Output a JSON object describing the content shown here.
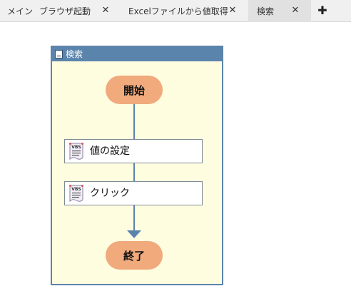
{
  "tabs": [
    {
      "label": "メイン",
      "closable": false,
      "active": false
    },
    {
      "label": "ブラウザ起動",
      "closable": true,
      "active": false
    },
    {
      "label": "Excelファイルから値取得",
      "closable": true,
      "active": false
    },
    {
      "label": "検索",
      "closable": true,
      "active": true
    }
  ],
  "tab_close_glyph": "✕",
  "tab_add_glyph": "✚",
  "flow": {
    "title": "検索",
    "start_label": "開始",
    "end_label": "終了",
    "actions": [
      {
        "label": "値の設定",
        "icon": "vbs-script-icon",
        "icon_text": "VBS"
      },
      {
        "label": "クリック",
        "icon": "vbs-script-icon",
        "icon_text": "VBS"
      }
    ]
  },
  "colors": {
    "accent_blue": "#5b84ad",
    "canvas_bg": "#fffde0",
    "terminal_fill": "#f0aa7c"
  }
}
